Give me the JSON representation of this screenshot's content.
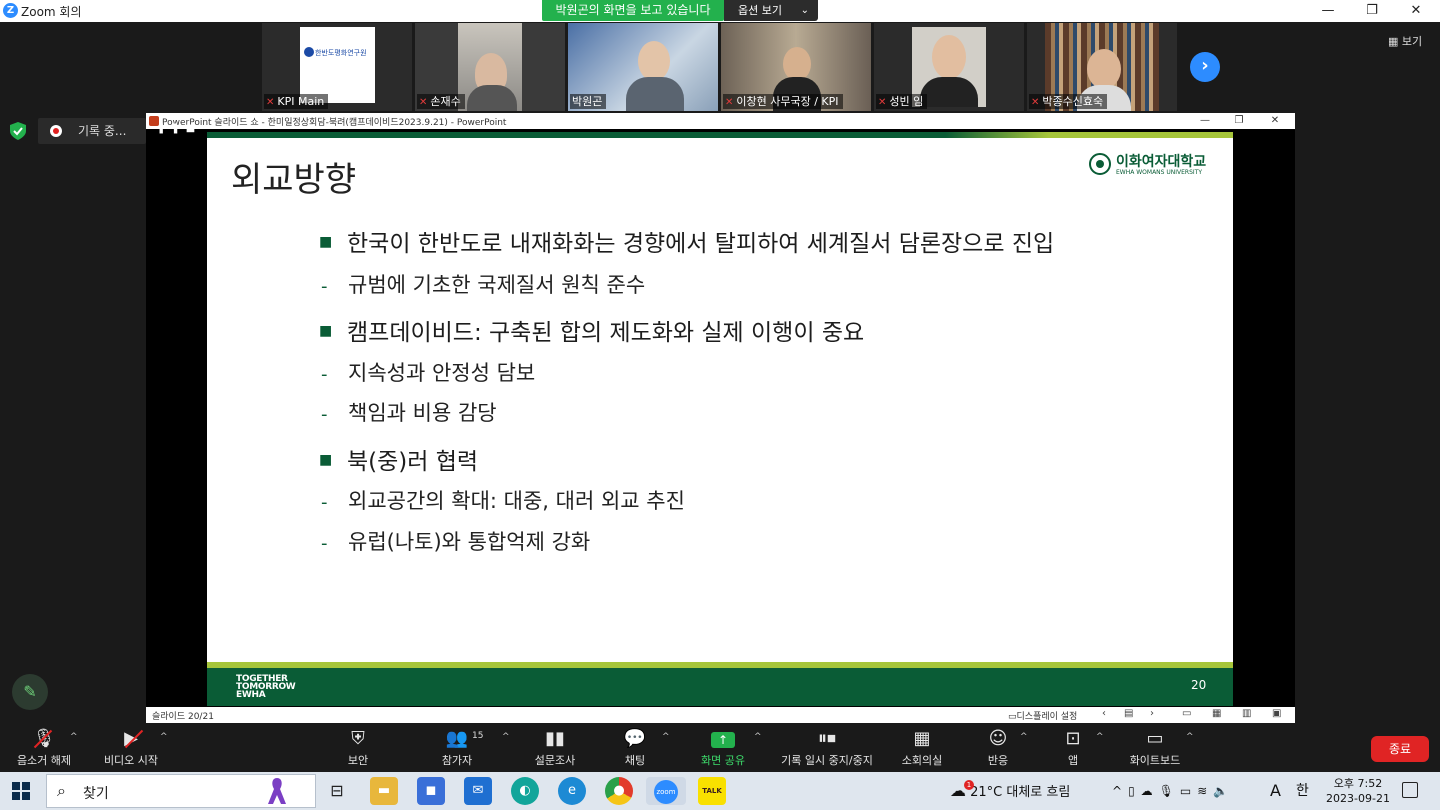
{
  "zoom": {
    "title": "Zoom 회의",
    "share_banner": "박원곤의 화면을 보고 있습니다",
    "view_options": "옵션 보기",
    "view_toggle": "보기",
    "recording_label": "기록 중..."
  },
  "participants": [
    {
      "name": "KPI Main",
      "muted": true,
      "logo_text": "한반도평화연구원"
    },
    {
      "name": "손재수",
      "muted": true
    },
    {
      "name": "박원곤",
      "muted": false,
      "active": true
    },
    {
      "name": "이창현 사무국장 / KPI",
      "muted": true
    },
    {
      "name": "성빈 임",
      "muted": true
    },
    {
      "name": "박종수신효숙",
      "muted": true
    }
  ],
  "ppt": {
    "window_title": "PowerPoint 슬라이드 쇼 - 한미일정상회담-북려(캠프데이비드2023.9.21) - PowerPoint",
    "status_slide": "슬라이드 20/21",
    "status_display": "디스플레이 설정"
  },
  "slide": {
    "title": "외교방향",
    "university_kr": "이화여자대학교",
    "university_en": "EWHA WOMANS UNIVERSITY",
    "footer_logo": [
      "TOGETHER",
      "TOMORROW",
      "EWHA"
    ],
    "page_number": "20",
    "bullets": [
      {
        "text": "한국이 한반도로 내재화화는 경향에서 탈피하여 세계질서 담론장으로 진입",
        "subs": [
          "규범에 기초한 국제질서 원칙 준수"
        ]
      },
      {
        "text": "캠프데이비드: 구축된 합의 제도화와 실제 이행이 중요",
        "subs": [
          "지속성과 안정성 담보",
          "책임과 비용 감당"
        ]
      },
      {
        "text": "북(중)러 협력",
        "subs": [
          "외교공간의 확대: 대중, 대러 외교 추진",
          "유럽(나토)와 통합억제 강화"
        ]
      }
    ]
  },
  "toolbar": {
    "mute": "음소거 해제",
    "video": "비디오 시작",
    "security": "보안",
    "participants": "참가자",
    "participant_count": "15",
    "polls": "설문조사",
    "chat": "채팅",
    "share": "화면 공유",
    "record": "기록 일시 중지/중지",
    "breakout": "소회의실",
    "reactions": "반응",
    "apps": "앱",
    "whiteboard": "화이트보드",
    "end": "종료"
  },
  "taskbar": {
    "search_placeholder": "찾기",
    "weather": "21°C 대체로 흐림",
    "ime_a": "A",
    "ime_han": "한",
    "time": "오후 7:52",
    "date": "2023-09-21",
    "zoom_icon_label": "zoom",
    "talk_icon_label": "TALK",
    "weather_badge": "1"
  },
  "colors": {
    "ewha_green": "#0a5c36",
    "accent_lime": "#a6c53a",
    "zoom_blue": "#2d8cff",
    "share_green": "#23b14d",
    "end_red": "#e02424"
  }
}
